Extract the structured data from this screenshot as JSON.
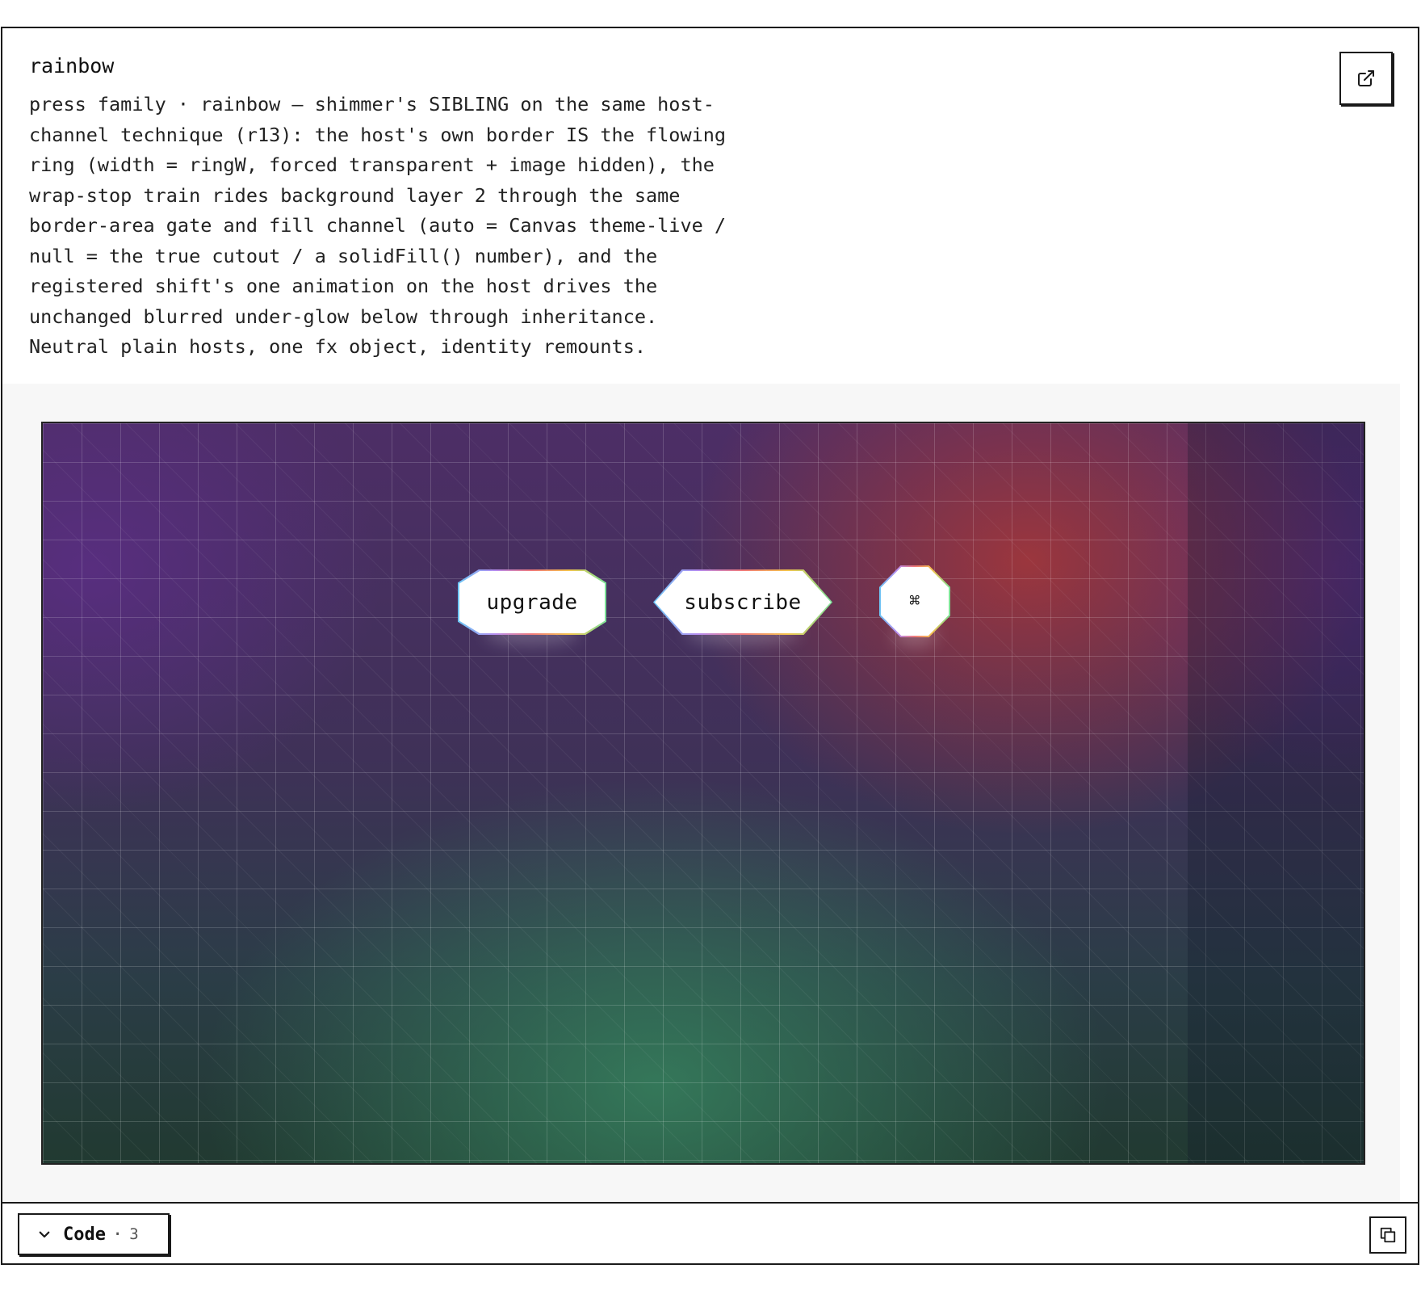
{
  "panel": {
    "title": "rainbow",
    "description": "press family · rainbow — shimmer's SIBLING on the same host-\nchannel technique (r13): the host's own border IS the flowing\nring (width = ringW, forced transparent + image hidden), the\nwrap-stop train rides background layer 2 through the same\nborder-area gate and fill channel (auto = Canvas theme-live /\nnull = the true cutout / a solidFill() number), and the\nregistered shift's one animation on the host drives the\nunchanged blurred under-glow below through inheritance.\nNeutral plain hosts, one fx object, identity remounts.",
    "open_icon": "external-link-icon"
  },
  "demo": {
    "buttons": [
      {
        "label": "upgrade"
      },
      {
        "label": "subscribe"
      },
      {
        "label": "⌘"
      }
    ],
    "ring_colors": [
      "#6cc7f5",
      "#b58cf0",
      "#f07a7a",
      "#f3c34d",
      "#7be39a"
    ]
  },
  "footer": {
    "code_label": "Code",
    "separator": "·",
    "code_count": "3",
    "chevron_icon": "chevron-down-icon",
    "copy_icon": "copy-icon"
  }
}
